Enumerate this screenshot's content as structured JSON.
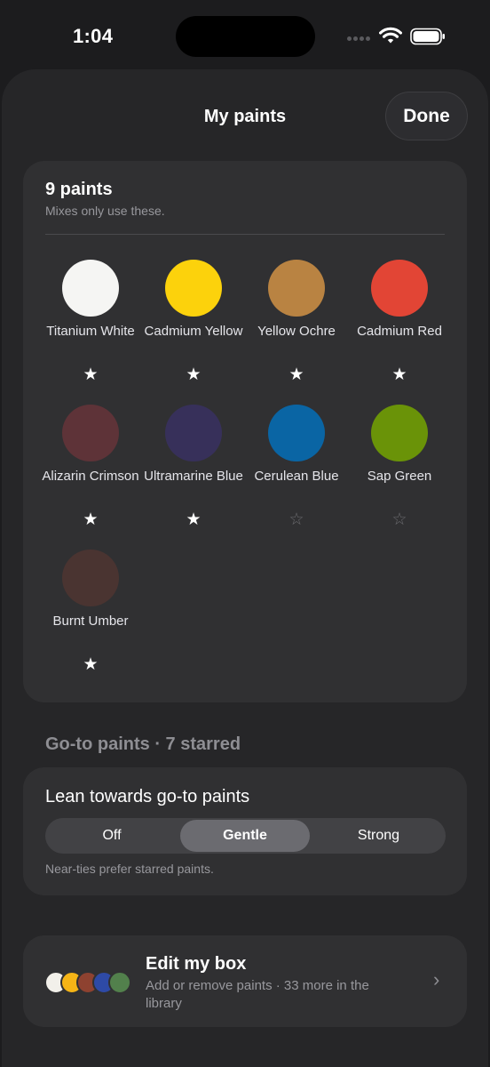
{
  "status_bar": {
    "time": "1:04"
  },
  "header": {
    "title": "My paints",
    "done_label": "Done"
  },
  "paints_card": {
    "title": "9 paints",
    "subtitle": "Mixes only use these.",
    "paints": [
      {
        "name": "Titanium White",
        "color": "#f5f5f3",
        "starred": true
      },
      {
        "name": "Cadmium Yellow",
        "color": "#fcd20c",
        "starred": true
      },
      {
        "name": "Yellow Ochre",
        "color": "#b98342",
        "starred": true
      },
      {
        "name": "Cadmium Red",
        "color": "#e24535",
        "starred": true
      },
      {
        "name": "Alizarin Crimson",
        "color": "#5e3338",
        "starred": true
      },
      {
        "name": "Ultramarine Blue",
        "color": "#37305a",
        "starred": true
      },
      {
        "name": "Cerulean Blue",
        "color": "#0a65a4",
        "starred": false
      },
      {
        "name": "Sap Green",
        "color": "#6a9308",
        "starred": false
      },
      {
        "name": "Burnt Umber",
        "color": "#4a3431",
        "starred": true
      }
    ]
  },
  "goto_section": {
    "title": "Go-to paints · 7 starred"
  },
  "lean_card": {
    "title": "Lean towards go-to paints",
    "options": [
      "Off",
      "Gentle",
      "Strong"
    ],
    "selected": "Gentle",
    "note": "Near-ties prefer starred paints."
  },
  "edit_card": {
    "title": "Edit my box",
    "subtitle": "Add or remove paints · 33 more in the library",
    "swatch_colors": [
      "#f2f0ea",
      "#f5b416",
      "#8e4230",
      "#2e4aa6",
      "#52804c"
    ]
  },
  "icons": {
    "star_filled": "★",
    "star_empty": "☆",
    "chevron": "chevron-right-icon"
  }
}
